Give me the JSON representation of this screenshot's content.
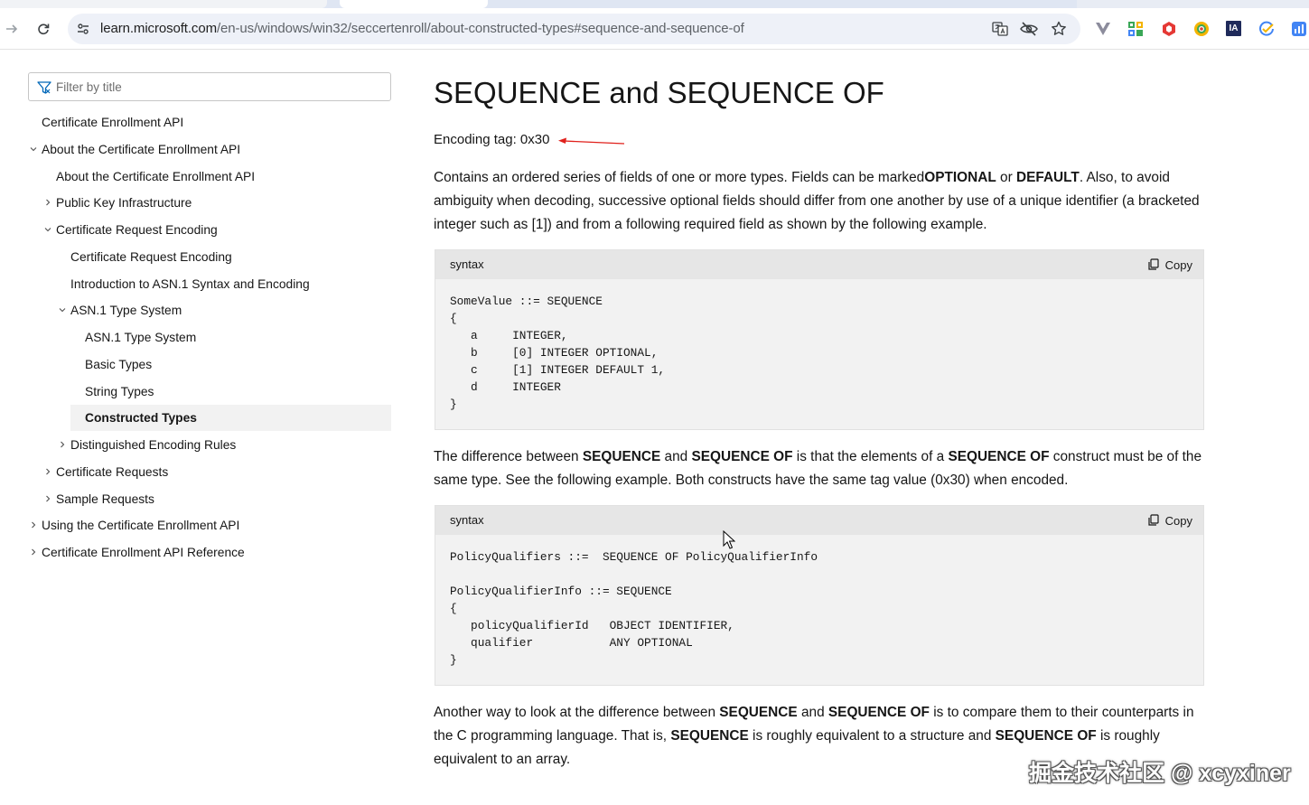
{
  "browser": {
    "url_host": "learn.microsoft.com",
    "url_path": "/en-us/windows/win32/seccertenroll/about-constructed-types#sequence-and-sequence-of"
  },
  "sidebar": {
    "filter_placeholder": "Filter by title",
    "items": [
      {
        "label": "Certificate Enrollment API",
        "level": 0,
        "toggle": "none"
      },
      {
        "label": "About the Certificate Enrollment API",
        "level": 0,
        "toggle": "expanded"
      },
      {
        "label": "About the Certificate Enrollment API",
        "level": 1,
        "toggle": "none"
      },
      {
        "label": "Public Key Infrastructure",
        "level": 1,
        "toggle": "collapsed"
      },
      {
        "label": "Certificate Request Encoding",
        "level": 1,
        "toggle": "expanded"
      },
      {
        "label": "Certificate Request Encoding",
        "level": 2,
        "toggle": "none"
      },
      {
        "label": "Introduction to ASN.1 Syntax and Encoding",
        "level": 2,
        "toggle": "none"
      },
      {
        "label": "ASN.1 Type System",
        "level": 2,
        "toggle": "expanded"
      },
      {
        "label": "ASN.1 Type System",
        "level": 3,
        "toggle": "none"
      },
      {
        "label": "Basic Types",
        "level": 3,
        "toggle": "none"
      },
      {
        "label": "String Types",
        "level": 3,
        "toggle": "none"
      },
      {
        "label": "Constructed Types",
        "level": 3,
        "toggle": "none",
        "selected": true
      },
      {
        "label": "Distinguished Encoding Rules",
        "level": 2,
        "toggle": "collapsed"
      },
      {
        "label": "Certificate Requests",
        "level": 1,
        "toggle": "collapsed"
      },
      {
        "label": "Sample Requests",
        "level": 1,
        "toggle": "collapsed"
      },
      {
        "label": "Using the Certificate Enrollment API",
        "level": 0,
        "toggle": "collapsed"
      },
      {
        "label": "Certificate Enrollment API Reference",
        "level": 0,
        "toggle": "collapsed"
      }
    ]
  },
  "main": {
    "title": "SEQUENCE and SEQUENCE OF",
    "encoding_tag": "Encoding tag: 0x30",
    "para1": [
      {
        "t": "Contains an ordered series of fields of one or more types. Fields can be marked"
      },
      {
        "b": "OPTIONAL"
      },
      {
        "t": " or "
      },
      {
        "b": "DEFAULT"
      },
      {
        "t": ". Also, to avoid ambiguity when decoding, successive optional fields should differ from one another by use of a unique identifier (a bracketed integer such as [1]) and from a following required field as shown by the following example."
      }
    ],
    "code1": {
      "lang": "syntax",
      "copy_label": "Copy",
      "code": "SomeValue ::= SEQUENCE \n{\n   a     INTEGER,\n   b     [0] INTEGER OPTIONAL,\n   c     [1] INTEGER DEFAULT 1,\n   d     INTEGER\n}"
    },
    "para2": [
      {
        "t": "The difference between "
      },
      {
        "b": "SEQUENCE"
      },
      {
        "t": " and "
      },
      {
        "b": "SEQUENCE OF"
      },
      {
        "t": " is that the elements of a "
      },
      {
        "b": "SEQUENCE OF"
      },
      {
        "t": " construct must be of the same type. See the following example. Both constructs have the same tag value (0x30) when encoded."
      }
    ],
    "code2": {
      "lang": "syntax",
      "copy_label": "Copy",
      "code": "PolicyQualifiers ::=  SEQUENCE OF PolicyQualifierInfo\n\nPolicyQualifierInfo ::= SEQUENCE \n{\n   policyQualifierId   OBJECT IDENTIFIER,\n   qualifier           ANY OPTIONAL\n}"
    },
    "para3": [
      {
        "t": "Another way to look at the difference between "
      },
      {
        "b": "SEQUENCE"
      },
      {
        "t": " and "
      },
      {
        "b": "SEQUENCE OF"
      },
      {
        "t": " is to compare them to their counterparts in the C programming language. That is, "
      },
      {
        "b": "SEQUENCE"
      },
      {
        "t": " is roughly equivalent to a structure and "
      },
      {
        "b": "SEQUENCE OF"
      },
      {
        "t": " is roughly equivalent to an array."
      }
    ]
  },
  "annotation_color": "#e0201b",
  "watermark": "掘金技术社区 @ xcyxiner"
}
